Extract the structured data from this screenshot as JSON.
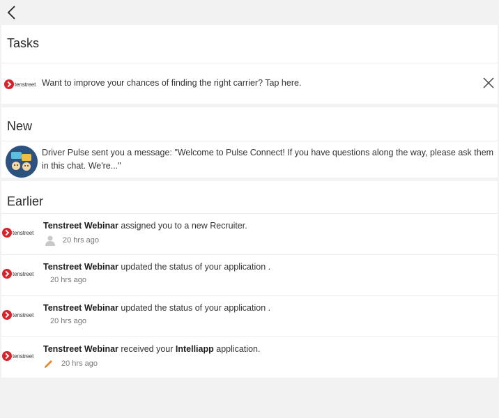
{
  "tasks": {
    "header": "Tasks",
    "item": {
      "logo_text": "tenstreet",
      "text": "Want to improve your chances of finding the right carrier? Tap here."
    }
  },
  "new_section": {
    "header": "New",
    "message": "Driver Pulse sent you a message: \"Welcome to Pulse Connect! If you have questions along the way, please ask them in this chat. We're...\""
  },
  "earlier": {
    "header": "Earlier",
    "items": [
      {
        "logo_text": "tenstreet",
        "actor": "Tenstreet Webinar",
        "text": " assigned you to a new Recruiter.",
        "time": "20 hrs ago",
        "icon": "person-icon"
      },
      {
        "logo_text": "tenstreet",
        "actor": "Tenstreet Webinar",
        "text": " updated the status of your application .",
        "time": "20 hrs ago",
        "icon": ""
      },
      {
        "logo_text": "tenstreet",
        "actor": "Tenstreet Webinar",
        "text": " updated the status of your application .",
        "time": "20 hrs ago",
        "icon": ""
      },
      {
        "logo_text": "tenstreet",
        "actor": "Tenstreet Webinar",
        "text": " received your ",
        "object": "Intelliapp",
        "text2": " application.",
        "time": "20 hrs ago",
        "icon": "pencil-icon"
      }
    ]
  },
  "colors": {
    "brand_red": "#d8232a",
    "avatar_blue": "#2c5282",
    "pencil_orange": "#e98a2a"
  }
}
